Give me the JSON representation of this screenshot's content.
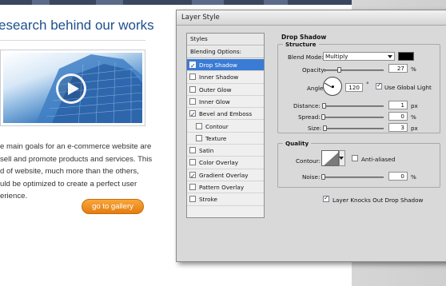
{
  "page": {
    "heading": "esearch behind our works",
    "body_lines": [
      "e main goals for an e-commerce website are",
      "sell and promote products and services. This",
      "d of website, much more than the others,",
      "uld be optimized to create a perfect user",
      "erience."
    ],
    "gallery_button": "go to gallery"
  },
  "dialog": {
    "title": "Layer Style",
    "styles_panel": {
      "header": "Styles",
      "blending_options": "Blending Options: Custom",
      "items": [
        {
          "label": "Drop Shadow",
          "checked": true,
          "active": true,
          "indent": false
        },
        {
          "label": "Inner Shadow",
          "checked": false,
          "active": false,
          "indent": false
        },
        {
          "label": "Outer Glow",
          "checked": false,
          "active": false,
          "indent": false
        },
        {
          "label": "Inner Glow",
          "checked": false,
          "active": false,
          "indent": false
        },
        {
          "label": "Bevel and Emboss",
          "checked": true,
          "active": false,
          "indent": false
        },
        {
          "label": "Contour",
          "checked": false,
          "active": false,
          "indent": true
        },
        {
          "label": "Texture",
          "checked": false,
          "active": false,
          "indent": true
        },
        {
          "label": "Satin",
          "checked": false,
          "active": false,
          "indent": false
        },
        {
          "label": "Color Overlay",
          "checked": false,
          "active": false,
          "indent": false
        },
        {
          "label": "Gradient Overlay",
          "checked": true,
          "active": false,
          "indent": false
        },
        {
          "label": "Pattern Overlay",
          "checked": false,
          "active": false,
          "indent": false
        },
        {
          "label": "Stroke",
          "checked": false,
          "active": false,
          "indent": false
        }
      ]
    },
    "drop_shadow": {
      "section_title": "Drop Shadow",
      "structure_title": "Structure",
      "blend_mode_label": "Blend Mode:",
      "blend_mode_value": "Multiply",
      "shadow_color": "#000000",
      "opacity_label": "Opacity:",
      "opacity_value": "27",
      "opacity_fraction": 0.27,
      "percent_unit": "%",
      "angle_label": "Angle:",
      "angle_value": "120",
      "degree_symbol": "°",
      "use_global_light_label": "Use Global Light",
      "use_global_light_checked": true,
      "distance_label": "Distance:",
      "distance_value": "1",
      "spread_label": "Spread:",
      "spread_value": "0",
      "size_label": "Size:",
      "size_value": "3",
      "px_unit": "px",
      "quality_title": "Quality",
      "contour_label": "Contour:",
      "anti_aliased_label": "Anti-aliased",
      "anti_aliased_checked": false,
      "noise_label": "Noise:",
      "noise_value": "0",
      "knockout_label": "Layer Knocks Out Drop Shadow",
      "knockout_checked": true
    }
  },
  "colors": {
    "heading": "#1c4f8c",
    "button_orange": "#f39a2b",
    "selection_blue": "#3a7bd5"
  }
}
